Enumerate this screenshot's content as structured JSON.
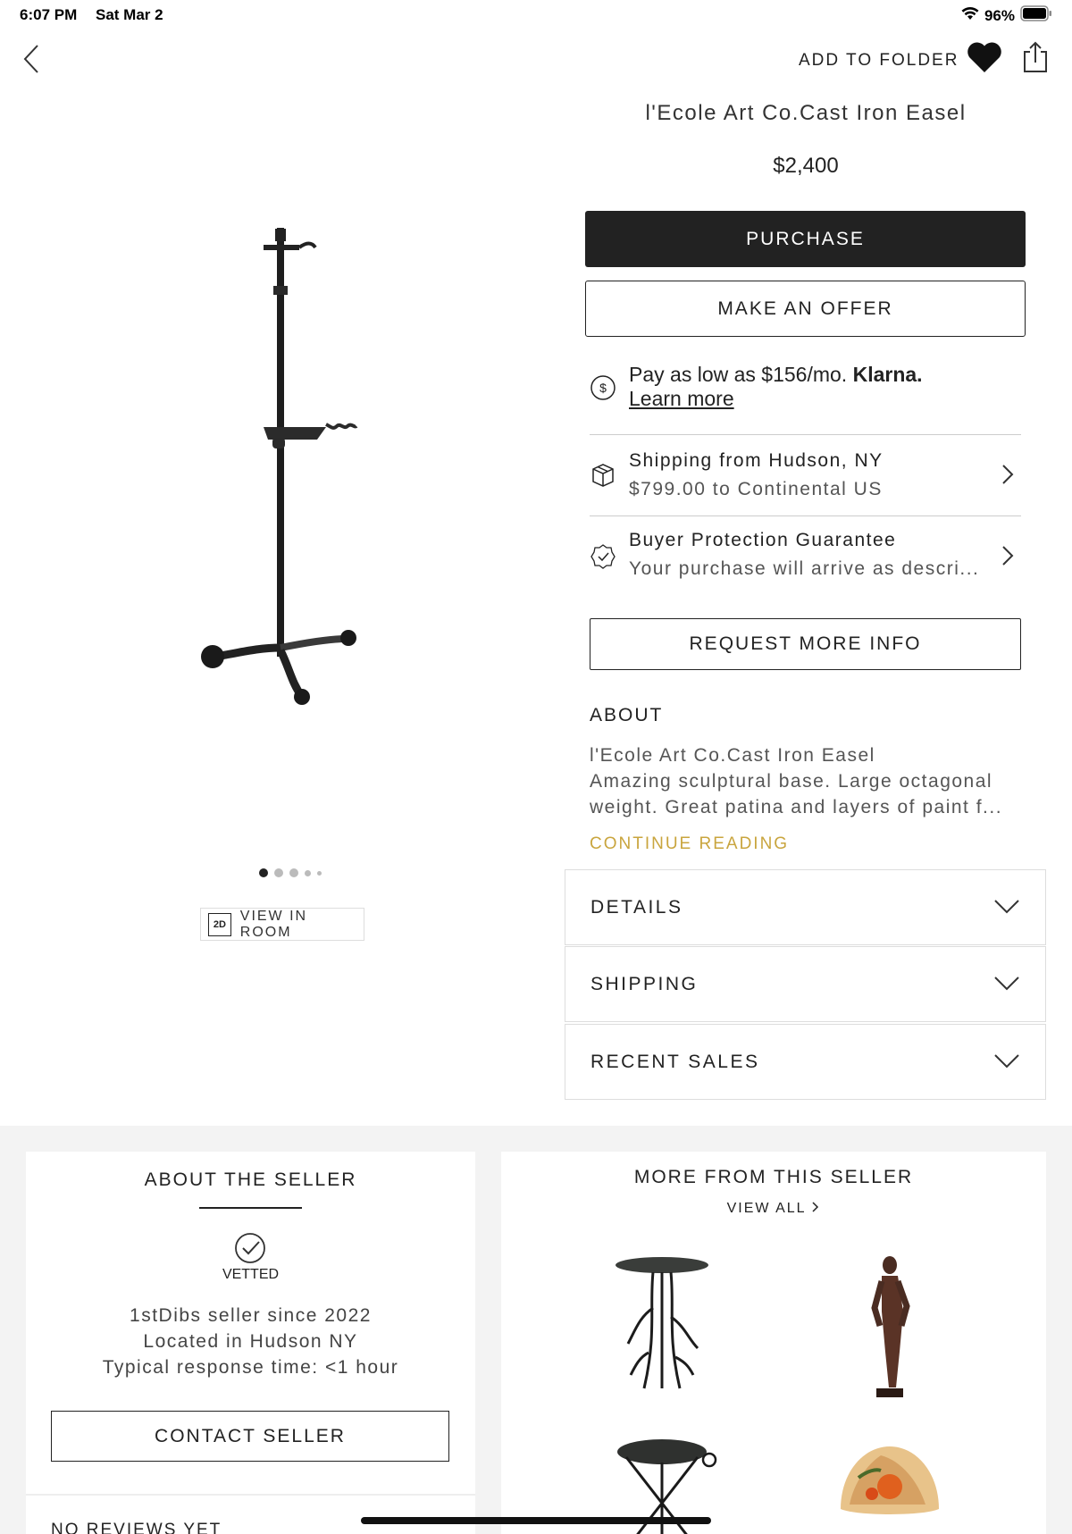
{
  "status_bar": {
    "time": "6:07 PM",
    "date": "Sat Mar 2",
    "battery": "96%"
  },
  "nav": {
    "add_to_folder": "ADD TO FOLDER"
  },
  "product": {
    "title": "l'Ecole Art Co.Cast Iron Easel",
    "price": "$2,400",
    "purchase_label": "PURCHASE",
    "offer_label": "MAKE AN OFFER",
    "image_count": 5,
    "view_in_room": {
      "badge": "2D",
      "label": "VIEW IN ROOM"
    }
  },
  "klarna": {
    "text": "Pay as low as $156/mo.",
    "brand": "Klarna.",
    "learn_more": "Learn more"
  },
  "shipping_row": {
    "title": "Shipping from Hudson, NY",
    "subtitle": "$799.00 to Continental US"
  },
  "protection_row": {
    "title": "Buyer Protection Guarantee",
    "subtitle": "Your purchase will arrive as descri..."
  },
  "request_info_label": "REQUEST MORE INFO",
  "about": {
    "heading": "ABOUT",
    "line1": "l'Ecole Art Co.Cast Iron Easel",
    "line2": "Amazing sculptural base. Large octagonal",
    "line3": "weight. Great patina and layers of paint f...",
    "continue": "CONTINUE READING"
  },
  "accordions": [
    {
      "label": "DETAILS"
    },
    {
      "label": "SHIPPING"
    },
    {
      "label": "RECENT SALES"
    }
  ],
  "seller": {
    "title": "ABOUT THE SELLER",
    "vetted": "VETTED",
    "since": "1stDibs seller since 2022",
    "location": "Located in Hudson NY",
    "response": "Typical response time: <1 hour",
    "contact_label": "CONTACT SELLER",
    "reviews": "NO REVIEWS YET"
  },
  "more_from_seller": {
    "title": "MORE FROM THIS SELLER",
    "view_all": "VIEW ALL"
  },
  "colors": {
    "accent_gold": "#c9a53e",
    "dark": "#222222",
    "background_band": "#f3f3f3"
  }
}
